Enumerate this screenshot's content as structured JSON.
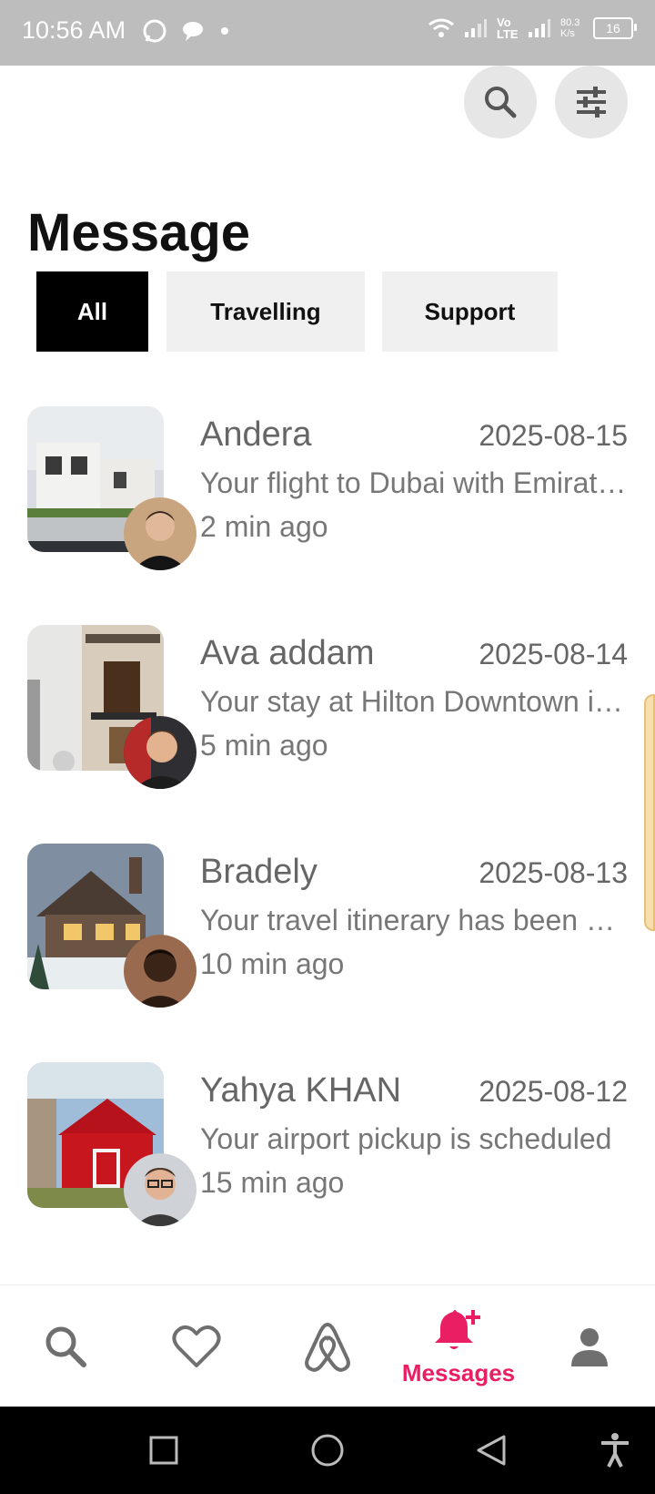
{
  "status_bar": {
    "time": "10:56 AM",
    "network_speed": "80.3\nK/s",
    "network_type": "Vo LTE",
    "battery": "16"
  },
  "page": {
    "title": "Message"
  },
  "tabs": [
    {
      "label": "All",
      "selected": true
    },
    {
      "label": "Travelling",
      "selected": false
    },
    {
      "label": "Support",
      "selected": false
    }
  ],
  "messages": [
    {
      "name": "Andera",
      "date": "2025-08-15",
      "preview": "Your flight to Dubai with Emirates is confirmed",
      "time_ago": "2 min ago"
    },
    {
      "name": "Ava addam",
      "date": "2025-08-14",
      "preview": "Your stay at Hilton Downtown is confirmed",
      "time_ago": "5 min ago"
    },
    {
      "name": "Bradely",
      "date": "2025-08-13",
      "preview": "Your travel itinerary has been updated",
      "time_ago": "10 min ago"
    },
    {
      "name": "Yahya KHAN",
      "date": "2025-08-12",
      "preview": "Your airport pickup is scheduled",
      "time_ago": "15 min ago"
    }
  ],
  "bottom_nav": {
    "items": [
      {
        "icon": "search-icon"
      },
      {
        "icon": "heart-icon"
      },
      {
        "icon": "airbnb-logo-icon"
      },
      {
        "icon": "bell-plus-icon",
        "label": "Messages",
        "active": true
      },
      {
        "icon": "profile-icon"
      }
    ]
  },
  "colors": {
    "accent": "#e91e63",
    "tab_selected_bg": "#000000",
    "tab_bg": "#f0f0f0"
  }
}
